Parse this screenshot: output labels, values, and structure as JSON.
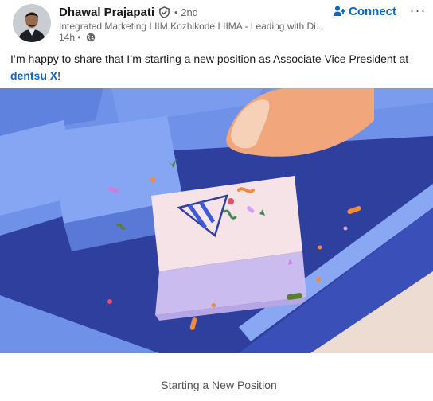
{
  "author": {
    "name": "Dhawal Prajapati",
    "degree": "• 2nd",
    "headline": "Integrated Marketing I IIM Kozhikode I IIMA - Leading with Di...",
    "time": "14h •"
  },
  "actions": {
    "connect_label": "Connect",
    "more_label": "···"
  },
  "post": {
    "text_before": "I’m happy to share that I’m starting a new position as Associate Vice President at ",
    "company": "dentsu X",
    "text_after": "!"
  },
  "media": {
    "caption": "Starting a New Position"
  },
  "icons": {
    "verified": "verified-shield-icon",
    "globe": "globe-icon",
    "connect": "add-person-icon",
    "more": "ellipsis-icon"
  },
  "colors": {
    "accent": "#0a66c2",
    "illustration_background": "#6f91e8",
    "keyboard_deck": "#2f3f9e"
  }
}
